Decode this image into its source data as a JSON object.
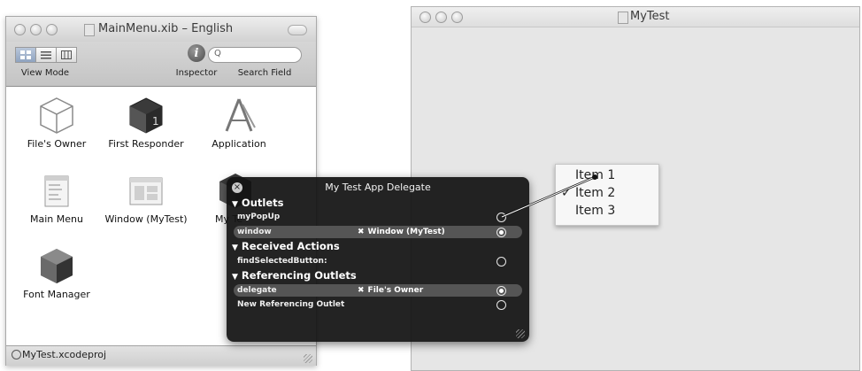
{
  "xib_window": {
    "title": "MainMenu.xib – English",
    "toolbar": {
      "view_mode_label": "View Mode",
      "inspector_label": "Inspector",
      "search_label": "Search Field",
      "search_glyph": "Q"
    },
    "objects": [
      {
        "label": "File's Owner",
        "icon": "cube-wireframe-icon"
      },
      {
        "label": "First Responder",
        "icon": "responder-cube-icon"
      },
      {
        "label": "Application",
        "icon": "application-icon"
      },
      {
        "label": "Main Menu",
        "icon": "menu-icon"
      },
      {
        "label": "Window (MyTest)",
        "icon": "window-icon"
      },
      {
        "label": "My Te",
        "icon": "object-cube-icon"
      },
      {
        "label": "Font Manager",
        "icon": "font-manager-icon"
      }
    ],
    "status_project": "MyTest.xcodeproj"
  },
  "mytest_window": {
    "title": "MyTest"
  },
  "popup_menu": {
    "items": [
      "Item 1",
      "Item 2",
      "Item 3"
    ],
    "checked_index": 1,
    "check_glyph": "✓"
  },
  "connections_panel": {
    "title": "My Test App Delegate",
    "sections": {
      "outlets": "Outlets",
      "received_actions": "Received Actions",
      "referencing_outlets": "Referencing Outlets"
    },
    "rows": {
      "outlet_1": "myPopUp",
      "outlet_2": "window",
      "outlet_2_target": "Window (MyTest)",
      "action_1": "findSelectedButton:",
      "ref_1": "delegate",
      "ref_1_target": "File's Owner",
      "ref_new": "New Referencing Outlet"
    }
  }
}
